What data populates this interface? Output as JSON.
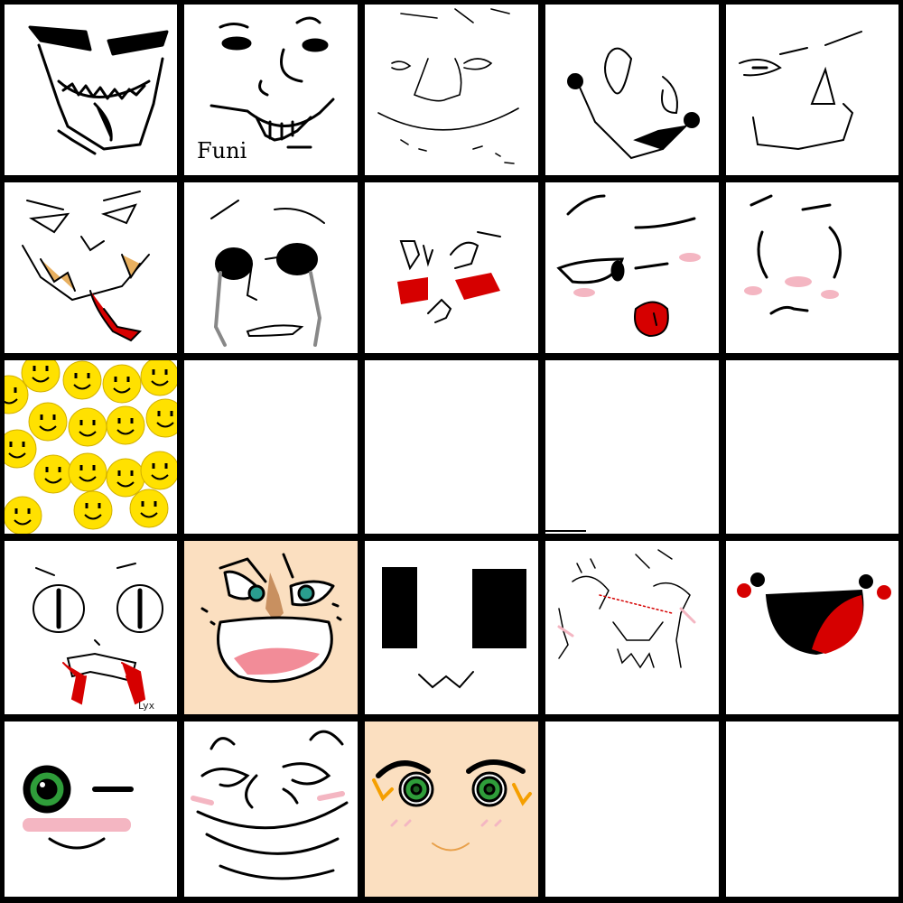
{
  "board": {
    "title": "",
    "rows": 5,
    "columns": 5,
    "grid_color": "#000000",
    "background": "#ffffff"
  },
  "cells": [
    {
      "id": "r1c1",
      "icon": "laughing-sharp-teeth-face-icon",
      "background": "#ffffff"
    },
    {
      "id": "r1c2",
      "icon": "smug-grin-face-icon",
      "background": "#ffffff",
      "caption": "Funi"
    },
    {
      "id": "r1c3",
      "icon": "squinting-smile-face-icon",
      "background": "#ffffff"
    },
    {
      "id": "r1c4",
      "icon": "wide-grin-face-icon",
      "background": "#ffffff"
    },
    {
      "id": "r1c5",
      "icon": "skeptical-face-icon",
      "background": "#ffffff"
    },
    {
      "id": "r2c1",
      "icon": "evil-tongue-grin-face-icon",
      "background": "#ffffff"
    },
    {
      "id": "r2c2",
      "icon": "crying-face-icon",
      "background": "#ffffff"
    },
    {
      "id": "r2c3",
      "icon": "angry-blush-face-icon",
      "background": "#ffffff"
    },
    {
      "id": "r2c4",
      "icon": "tongue-out-blush-face-icon",
      "background": "#ffffff"
    },
    {
      "id": "r2c5",
      "icon": "worried-blush-face-icon",
      "background": "#ffffff"
    },
    {
      "id": "r3c1",
      "icon": "yellow-smiley-crowd-icon",
      "background": "#ffffff"
    },
    {
      "id": "r3c2",
      "icon": "empty-cell",
      "background": "#ffffff"
    },
    {
      "id": "r3c3",
      "icon": "empty-cell",
      "background": "#ffffff"
    },
    {
      "id": "r3c4",
      "icon": "empty-cell",
      "background": "#ffffff"
    },
    {
      "id": "r3c5",
      "icon": "empty-cell",
      "background": "#ffffff"
    },
    {
      "id": "r4c1",
      "icon": "cat-eye-fang-face-icon",
      "background": "#ffffff",
      "caption": "Lyx"
    },
    {
      "id": "r4c2",
      "icon": "manic-grin-face-icon",
      "background": "#fbdfc0"
    },
    {
      "id": "r4c3",
      "icon": "square-eye-uwu-face-icon",
      "background": "#ffffff"
    },
    {
      "id": "r4c4",
      "icon": "flustered-sweat-face-icon",
      "background": "#ffffff"
    },
    {
      "id": "r4c5",
      "icon": "red-mouth-blush-face-icon",
      "background": "#ffffff"
    },
    {
      "id": "r5c1",
      "icon": "winking-blush-face-icon",
      "background": "#ffffff"
    },
    {
      "id": "r5c2",
      "icon": "trollface-blush-icon",
      "background": "#ffffff"
    },
    {
      "id": "r5c3",
      "icon": "green-eye-blush-face-icon",
      "background": "#fbdfc0"
    },
    {
      "id": "r5c4",
      "icon": "empty-cell",
      "background": "#ffffff"
    },
    {
      "id": "r5c5",
      "icon": "empty-cell",
      "background": "#ffffff"
    }
  ],
  "colors": {
    "blood_red": "#d60000",
    "blush_pink": "#f4b6c2",
    "smiley_yellow": "#ffe100",
    "skin_peach": "#fbdfc0",
    "eye_green": "#2f9d3a",
    "eye_teal": "#2a9d8f"
  }
}
